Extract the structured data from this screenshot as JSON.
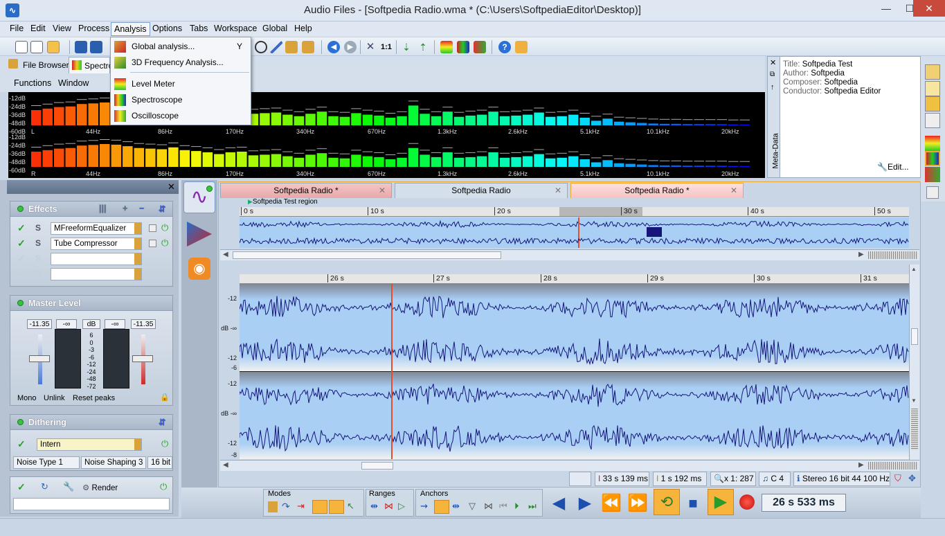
{
  "window": {
    "title": "Audio Files - [Softpedia Radio.wma * (C:\\Users\\SoftpediaEditor\\Desktop)]",
    "minimize": "—",
    "maximize": "☐",
    "close": "✕"
  },
  "menu": [
    "File",
    "Edit",
    "View",
    "Process",
    "Analysis",
    "Options",
    "Tabs",
    "Workspace",
    "Global",
    "Help"
  ],
  "analysis_menu": [
    {
      "label": "Global analysis...",
      "shortcut": "Y",
      "icon": "global-analysis-icon"
    },
    {
      "label": "3D Frequency Analysis...",
      "shortcut": "",
      "icon": "3d-frequency-icon"
    },
    {
      "label": "Level Meter",
      "shortcut": "",
      "icon": "level-meter-icon"
    },
    {
      "label": "Spectroscope",
      "shortcut": "",
      "icon": "spectroscope-icon"
    },
    {
      "label": "Oscilloscope",
      "shortcut": "",
      "icon": "oscilloscope-icon"
    }
  ],
  "toolbar": {
    "zoom_label": "1:1"
  },
  "top_tabs": {
    "file_browser": "File Browser",
    "spectro": "Spectro"
  },
  "func_menu": {
    "functions": "Functions",
    "window": "Window"
  },
  "spectrum": {
    "db_labels_top": [
      "-12dB",
      "-24dB",
      "-36dB",
      "-48dB",
      "-60dB"
    ],
    "db_labels_bottom": [
      "-12dB",
      "-24dB",
      "-36dB",
      "-48dB",
      "-60dB"
    ],
    "freq_labels": [
      "44Hz",
      "86Hz",
      "170Hz",
      "340Hz",
      "670Hz",
      "1.3kHz",
      "2.6kHz",
      "5.1kHz",
      "10.1kHz",
      "20kHz"
    ],
    "ch_left": "L",
    "ch_right": "R",
    "left_levels": [
      0.5,
      0.55,
      0.6,
      0.62,
      0.7,
      0.72,
      0.75,
      0.73,
      0.68,
      0.6,
      0.58,
      0.55,
      0.62,
      0.55,
      0.5,
      0.48,
      0.42,
      0.45,
      0.5,
      0.38,
      0.4,
      0.42,
      0.35,
      0.3,
      0.38,
      0.45,
      0.3,
      0.28,
      0.4,
      0.35,
      0.32,
      0.25,
      0.3,
      0.65,
      0.38,
      0.3,
      0.45,
      0.28,
      0.32,
      0.35,
      0.45,
      0.3,
      0.32,
      0.35,
      0.42,
      0.28,
      0.3,
      0.35,
      0.25,
      0.15,
      0.22,
      0.12,
      0.1,
      0.08,
      0.06,
      0.05,
      0.05,
      0.04,
      0.04,
      0.04,
      0.04,
      0.03,
      0.03
    ],
    "right_levels": [
      0.5,
      0.55,
      0.6,
      0.62,
      0.7,
      0.72,
      0.75,
      0.73,
      0.68,
      0.62,
      0.6,
      0.58,
      0.64,
      0.55,
      0.52,
      0.48,
      0.42,
      0.48,
      0.5,
      0.38,
      0.4,
      0.42,
      0.35,
      0.3,
      0.4,
      0.45,
      0.3,
      0.28,
      0.4,
      0.35,
      0.32,
      0.25,
      0.3,
      0.62,
      0.4,
      0.32,
      0.48,
      0.3,
      0.32,
      0.35,
      0.48,
      0.3,
      0.32,
      0.35,
      0.42,
      0.28,
      0.3,
      0.35,
      0.25,
      0.15,
      0.22,
      0.12,
      0.1,
      0.08,
      0.06,
      0.05,
      0.05,
      0.04,
      0.04,
      0.04,
      0.04,
      0.03,
      0.03
    ]
  },
  "meta": {
    "title_label": "Title:",
    "title": "Softpedia Test",
    "author_label": "Author:",
    "author": "Softpedia",
    "composer_label": "Composer:",
    "composer": "Softpedia",
    "conductor_label": "Conductor:",
    "conductor": "Softpedia Editor",
    "side_label": "Meta-Data",
    "edit": "Edit..."
  },
  "effects": {
    "title": "Effects",
    "slots": [
      {
        "name": "MFreeformEqualizer",
        "active": true
      },
      {
        "name": "Tube Compressor",
        "active": true
      },
      {
        "name": "",
        "active": false
      },
      {
        "name": "",
        "active": false
      }
    ]
  },
  "master": {
    "title": "Master Level",
    "left_val": "-11.35",
    "inf1": "-∞",
    "db": "dB",
    "inf2": "-∞",
    "right_val": "-11.35",
    "scale": [
      "6",
      "0",
      "-3",
      "-6",
      "-12",
      "-24",
      "-48",
      "-72"
    ],
    "mono": "Mono",
    "unlink": "Unlink",
    "reset": "Reset peaks"
  },
  "dithering": {
    "title": "Dithering",
    "slot": "Intern",
    "noise_type": "Noise Type 1",
    "noise_shaping": "Noise Shaping 3",
    "bits": "16 bit"
  },
  "render": {
    "label": "Render"
  },
  "doc_tabs": [
    {
      "label": "Softpedia Radio *",
      "state": "modified"
    },
    {
      "label": "Softpedia Radio",
      "state": "normal"
    },
    {
      "label": "Softpedia Radio *",
      "state": "active"
    }
  ],
  "overview": {
    "region": "Softpedia Test region",
    "ticks": [
      "0 s",
      "10 s",
      "20 s",
      "30 s",
      "40 s",
      "50 s"
    ]
  },
  "detail": {
    "ticks": [
      "26 s",
      "27 s",
      "28 s",
      "29 s",
      "30 s",
      "31 s"
    ],
    "axis": [
      "-12",
      "dB -∞",
      "-12",
      "-6",
      "-12",
      "dB -∞",
      "-12",
      "-8"
    ]
  },
  "status": {
    "length": "33 s 139 ms",
    "selection": "1 s 192 ms",
    "zoom": "x 1: 287",
    "key": "C 4",
    "format": "Stereo 16 bit 44 100 Hz"
  },
  "transport": {
    "modes": "Modes",
    "ranges": "Ranges",
    "anchors": "Anchors",
    "time": "26 s 533 ms"
  },
  "colors": {
    "accent": "#f0a830",
    "wave_bg": "#a9cff5",
    "wave_line": "#15157a",
    "cursor": "#e05030"
  }
}
